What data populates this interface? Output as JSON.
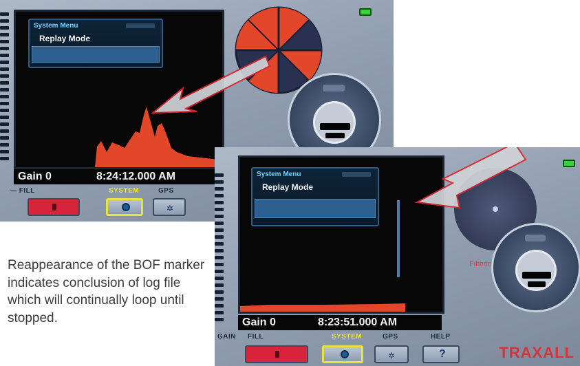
{
  "screenshot_1": {
    "menu": {
      "title": "System Menu",
      "item": "Replay Mode"
    },
    "status": {
      "gain": "Gain 0",
      "time": "8:24:12.000 AM"
    },
    "controls": {
      "gain_fill": "— FILL",
      "system": "SYSTEM",
      "gps": "GPS"
    }
  },
  "screenshot_2": {
    "menu": {
      "title": "System Menu",
      "item": "Replay Mode"
    },
    "status": {
      "gain": "Gain 0",
      "time": "8:23:51.000 AM"
    },
    "controls": {
      "gain": "GAIN",
      "fill": "FILL",
      "system": "SYSTEM",
      "gps": "GPS",
      "help": "HELP",
      "help_glyph": "?"
    },
    "gauge_label": "Filtering",
    "brand": "TRAXALL"
  },
  "caption": "Reappearance of the BOF marker indicates conclusion of log file which will continually loop until stopped.",
  "icons": [
    "gear-icon",
    "gps-icon",
    "battery-icon",
    "arrow-annotation",
    "fill-icon"
  ],
  "colors": {
    "accent_red": "#d8243a",
    "menu_blue": "#2c5f8f",
    "system_outline": "#e7e33a",
    "brand_red": "#d8323a",
    "arrow_outline": "#d9262e"
  }
}
